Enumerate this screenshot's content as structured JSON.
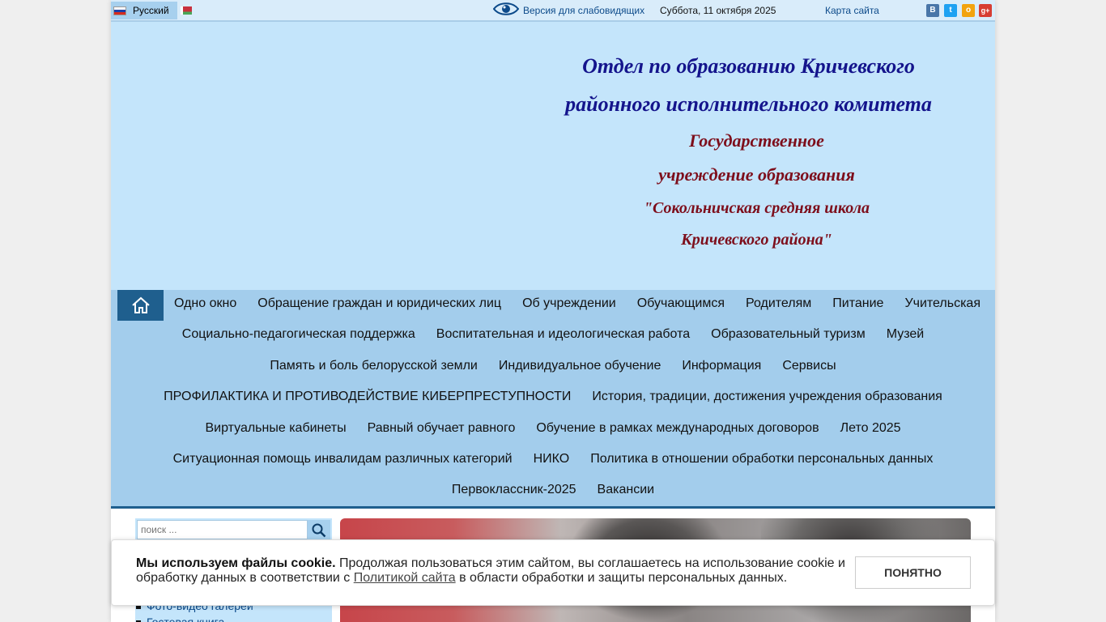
{
  "topbar": {
    "language": "Русский",
    "low_vision_label": "Версия для слабовидящих",
    "date": "Суббота, 11 октября 2025",
    "sitemap_label": "Карта сайта",
    "social": [
      "В",
      "t",
      "о",
      "g+"
    ]
  },
  "header": {
    "line1": "Отдел по образованию Кричевского",
    "line2": "районного исполнительного комитета",
    "line3": "Государственное",
    "line4": "учреждение образования",
    "line5": "\"Сокольничская средняя школа",
    "line6": "Кричевского района\""
  },
  "nav": {
    "rows": [
      [
        "Одно окно",
        "Обращение граждан и юридических лиц",
        "Об учреждении",
        "Обучающимся",
        "Родителям",
        "Питание",
        "Учительская"
      ],
      [
        "Социально-педагогическая поддержка",
        "Воспитательная и идеологическая работа",
        "Образовательный туризм",
        "Музей"
      ],
      [
        "Память и боль белорусской земли",
        "Индивидуальное обучение",
        "Информация",
        "Сервисы"
      ],
      [
        "ПРОФИЛАКТИКА И ПРОТИВОДЕЙСТВИЕ КИБЕРПРЕСТУПНОСТИ",
        "История, традиции, достижения учреждения образования"
      ],
      [
        "Виртуальные кабинеты",
        "Равный обучает равного",
        "Обучение в рамках международных договоров",
        "Лето 2025"
      ],
      [
        "Ситуационная помощь инвалидам различных категорий",
        "НИКО",
        "Политика в отношении обработки персональных данных"
      ],
      [
        "Первоклассник-2025",
        "Вакансии"
      ]
    ]
  },
  "search": {
    "placeholder": "поиск ..."
  },
  "sidebar": {
    "items": [
      "Фото-видео галереи",
      "Гостевая книга"
    ]
  },
  "cookie": {
    "title": "Мы используем файлы cookie.",
    "text1": " Продолжая пользоваться этим сайтом, вы соглашаетесь на использование cookie и обработку данных в соответствии с ",
    "link": "Политикой сайта",
    "text2": " в области обработки и защиты персональных данных.",
    "button": "ПОНЯТНО"
  },
  "colors": {
    "header_bg": "#c4e5fb",
    "nav_bg": "#a3cdec",
    "accent": "#1f5f8e",
    "title_blue": "#14148c",
    "title_red": "#7d0e1b"
  }
}
